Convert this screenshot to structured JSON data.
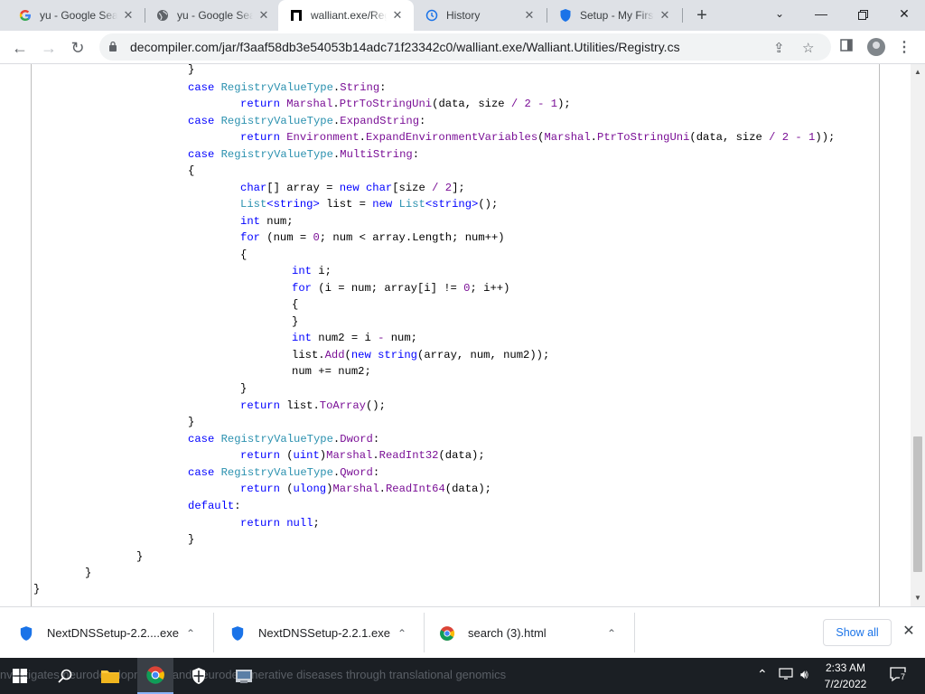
{
  "tabs": [
    {
      "title": "yu - Google Sea",
      "icon": "google-g-icon"
    },
    {
      "title": "yu - Google Sea",
      "icon": "globe-icon"
    },
    {
      "title": "walliant.exe/Reg",
      "icon": "decompiler-icon"
    },
    {
      "title": "History",
      "icon": "history-icon"
    },
    {
      "title": "Setup - My First",
      "icon": "nextdns-shield-icon"
    }
  ],
  "address_bar": {
    "url": "decompiler.com/jar/f3aaf58db3e54053b14adc71f23342c0/walliant.exe/Walliant.Utilities/Registry.cs"
  },
  "code": {
    "lines": [
      "}",
      "case RegistryValueType.String:",
      "return Marshal.PtrToStringUni(data, size / 2 - 1);",
      "case RegistryValueType.ExpandString:",
      "return Environment.ExpandEnvironmentVariables(Marshal.PtrToStringUni(data, size / 2 - 1));",
      "case RegistryValueType.MultiString:",
      "{",
      "char[] array = new char[size / 2];",
      "List<string> list = new List<string>();",
      "int num;",
      "for (num = 0; num < array.Length; num++)",
      "{",
      "int i;",
      "for (i = num; array[i] != 0; i++)",
      "{",
      "}",
      "int num2 = i - num;",
      "list.Add(new string(array, num, num2));",
      "num += num2;",
      "}",
      "return list.ToArray();",
      "}",
      "case RegistryValueType.Dword:",
      "return (uint)Marshal.ReadInt32(data);",
      "case RegistryValueType.Qword:",
      "return (ulong)Marshal.ReadInt64(data);",
      "default:",
      "return null;",
      "}",
      "}",
      "}",
      "}"
    ]
  },
  "downloads": [
    {
      "name": "NextDNSSetup-2.2....exe",
      "icon": "nextdns-shield-icon"
    },
    {
      "name": "NextDNSSetup-2.2.1.exe",
      "icon": "nextdns-shield-icon"
    },
    {
      "name": "search (3).html",
      "icon": "chrome-icon"
    }
  ],
  "download_bar": {
    "show_all": "Show all"
  },
  "taskbar": {
    "ghost_text": "nvestigates neurodevelopmental and neurodegenerative diseases through translational genomics",
    "time": "2:33 AM",
    "date": "7/2/2022",
    "notifications": "7"
  },
  "colors": {
    "keyword": "#0000ff",
    "type": "#2b91af",
    "token": "#7a0f96",
    "accent": "#1a73e8"
  }
}
